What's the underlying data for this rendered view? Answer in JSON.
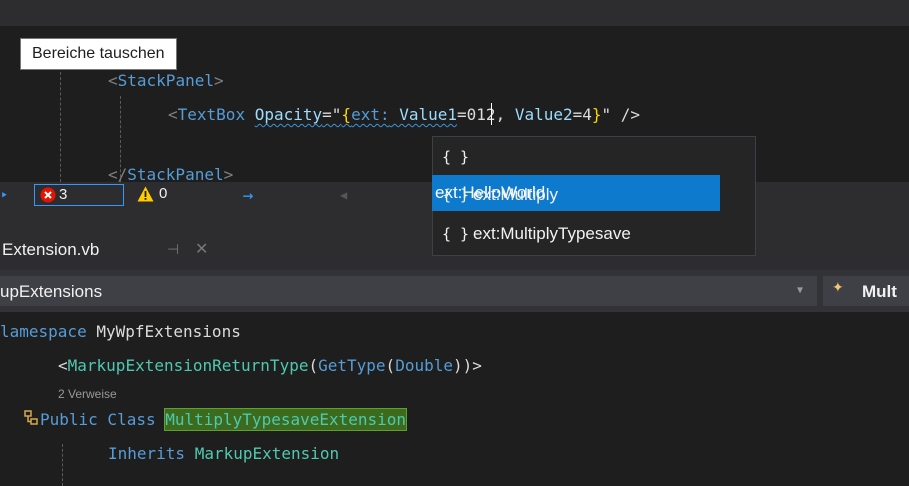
{
  "tooltip": "Bereiche tauschen",
  "xaml": {
    "line1": {
      "open": "<",
      "tag": "StackPanel",
      "close": ">"
    },
    "line2": {
      "open": "<",
      "tag": "TextBox",
      "attr": "Opacity",
      "eq": "=\"",
      "brace_open": "{",
      "ext": "ext:",
      "value1_attr": " Value1",
      "value1": "=012, ",
      "value2_attr": "Value2",
      "value2": "=4",
      "brace_close": "}",
      "tail": "\" />"
    },
    "line3": {
      "open": "</",
      "tag": "StackPanel",
      "close": ">"
    }
  },
  "status": {
    "errors": "3",
    "warnings": "0",
    "error_icon": "error-circle-icon",
    "warning_icon": "warning-triangle-icon",
    "arrow_icon": "arrow-right-icon"
  },
  "autocomplete": {
    "items": [
      {
        "icon": "{ }",
        "label": "ext:HelloWorld",
        "selected": true
      },
      {
        "icon": "{ }",
        "label": "ext:Multiply",
        "selected": false
      },
      {
        "icon": "{ }",
        "label": "ext:MultiplyTypesave",
        "selected": false
      }
    ]
  },
  "tab": {
    "title": "Extension.vb",
    "pin": "⊣",
    "close": "✕"
  },
  "navbar": {
    "left": "upExtensions",
    "right": "Mult"
  },
  "vb": {
    "line1": {
      "kw": "lamespace",
      "name": " MyWpfExtensions"
    },
    "line2": {
      "open": "<",
      "attr": "MarkupExtensionReturnType",
      "p1": "(",
      "fn": "GetType",
      "p2": "(",
      "arg": "Double",
      "p3": "))",
      "close": ">"
    },
    "refs": "2 Verweise",
    "line3": {
      "kw": "Public Class",
      "name": "MultiplyTypesaveExtension"
    },
    "line4": {
      "kw": "Inherits",
      "name": " MarkupExtension"
    }
  },
  "colors": {
    "accent": "#0e7acd",
    "selection_green": "#3c6b1e",
    "error": "#e51400",
    "warning": "#ffcc00"
  }
}
